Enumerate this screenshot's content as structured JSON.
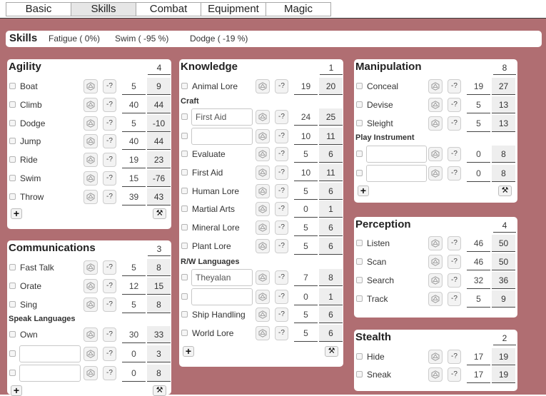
{
  "tabs": [
    "Basic",
    "Skills",
    "Combat",
    "Equipment",
    "Magic"
  ],
  "active_tab": "Skills",
  "skills_header": {
    "title": "Skills",
    "fatigue": "Fatigue ( 0%)",
    "swim": "Swim ( -95  %)",
    "dodge": "Dodge ( -19  %)"
  },
  "controls": {
    "roll_icon": "dice-icon",
    "unknown_label": "-?",
    "add_label": "+",
    "tools_icon": "crossed-tools-icon"
  },
  "agility": {
    "title": "Agility",
    "count": "4",
    "skills": [
      {
        "name": "Boat",
        "base": "5",
        "total": "9"
      },
      {
        "name": "Climb",
        "base": "40",
        "total": "44"
      },
      {
        "name": "Dodge",
        "base": "5",
        "total": "-10"
      },
      {
        "name": "Jump",
        "base": "40",
        "total": "44"
      },
      {
        "name": "Ride",
        "base": "19",
        "total": "23"
      },
      {
        "name": "Swim",
        "base": "15",
        "total": "-76"
      },
      {
        "name": "Throw",
        "base": "39",
        "total": "43"
      }
    ]
  },
  "communications": {
    "title": "Communications",
    "count": "3",
    "skills": [
      {
        "name": "Fast Talk",
        "base": "5",
        "total": "8"
      },
      {
        "name": "Orate",
        "base": "12",
        "total": "15"
      },
      {
        "name": "Sing",
        "base": "5",
        "total": "8"
      }
    ],
    "speak_label": "Speak Languages",
    "speak": [
      {
        "name": "Own",
        "base": "30",
        "total": "33"
      },
      {
        "value": "",
        "base": "0",
        "total": "3"
      },
      {
        "value": "",
        "base": "0",
        "total": "8"
      }
    ]
  },
  "knowledge": {
    "title": "Knowledge",
    "count": "1",
    "skills_a": [
      {
        "name": "Animal Lore",
        "base": "19",
        "total": "20"
      }
    ],
    "craft_label": "Craft",
    "craft": [
      {
        "value": "First Aid",
        "base": "24",
        "total": "25"
      },
      {
        "value": "",
        "base": "10",
        "total": "11"
      }
    ],
    "skills_b": [
      {
        "name": "Evaluate",
        "base": "5",
        "total": "6"
      },
      {
        "name": "First Aid",
        "base": "10",
        "total": "11"
      },
      {
        "name": "Human Lore",
        "base": "5",
        "total": "6"
      },
      {
        "name": "Martial Arts",
        "base": "0",
        "total": "1"
      },
      {
        "name": "Mineral Lore",
        "base": "5",
        "total": "6"
      },
      {
        "name": "Plant Lore",
        "base": "5",
        "total": "6"
      }
    ],
    "rw_label": "R/W Languages",
    "rw": [
      {
        "value": "Theyalan",
        "base": "7",
        "total": "8"
      },
      {
        "value": "",
        "base": "0",
        "total": "1"
      }
    ],
    "skills_c": [
      {
        "name": "Ship Handling",
        "base": "5",
        "total": "6"
      },
      {
        "name": "World Lore",
        "base": "5",
        "total": "6"
      }
    ]
  },
  "manipulation": {
    "title": "Manipulation",
    "count": "8",
    "skills": [
      {
        "name": "Conceal",
        "base": "19",
        "total": "27"
      },
      {
        "name": "Devise",
        "base": "5",
        "total": "13"
      },
      {
        "name": "Sleight",
        "base": "5",
        "total": "13"
      }
    ],
    "instrument_label": "Play Instrument",
    "instrument": [
      {
        "value": "",
        "base": "0",
        "total": "8"
      },
      {
        "value": "",
        "base": "0",
        "total": "8"
      }
    ]
  },
  "perception": {
    "title": "Perception",
    "count": "4",
    "skills": [
      {
        "name": "Listen",
        "base": "46",
        "total": "50"
      },
      {
        "name": "Scan",
        "base": "46",
        "total": "50"
      },
      {
        "name": "Search",
        "base": "32",
        "total": "36"
      },
      {
        "name": "Track",
        "base": "5",
        "total": "9"
      }
    ]
  },
  "stealth": {
    "title": "Stealth",
    "count": "2",
    "skills": [
      {
        "name": "Hide",
        "base": "17",
        "total": "19"
      },
      {
        "name": "Sneak",
        "base": "17",
        "total": "19"
      }
    ]
  }
}
